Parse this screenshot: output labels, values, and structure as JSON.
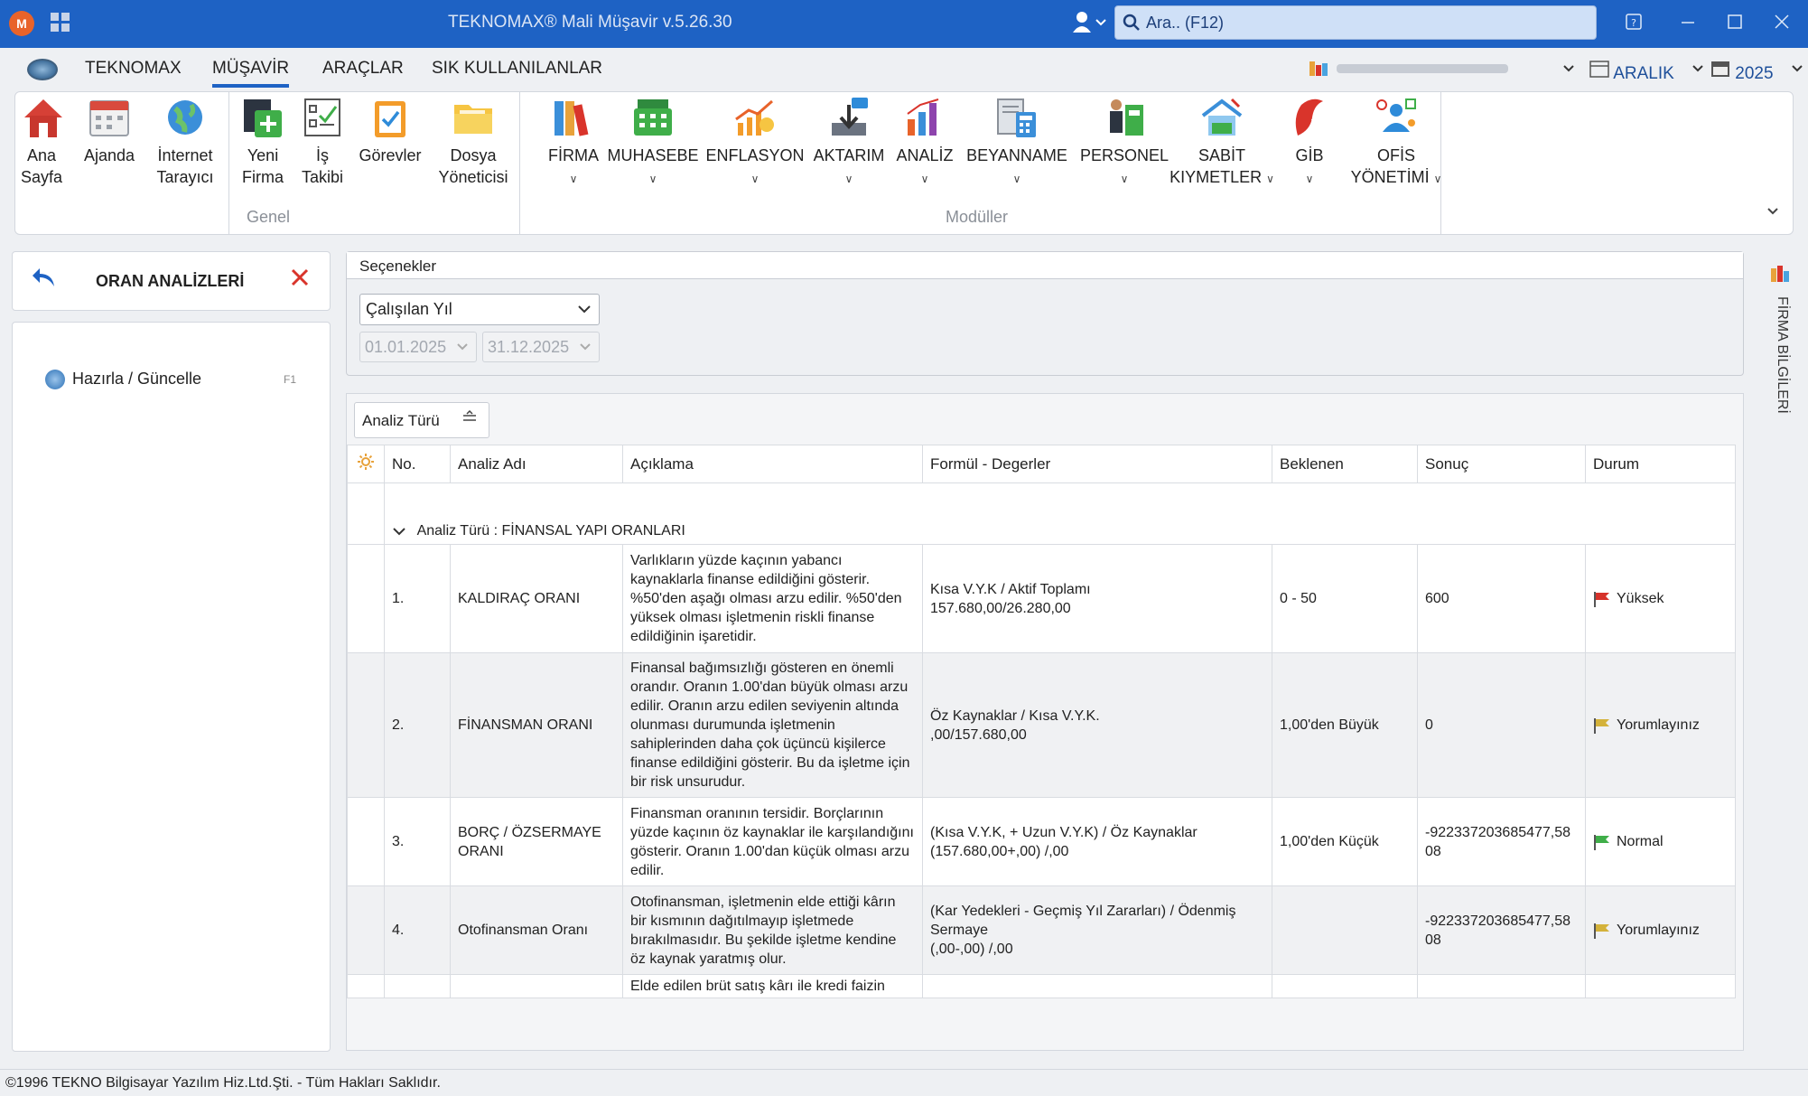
{
  "window": {
    "title": "TEKNOMAX® Mali Müşavir v.5.26.30",
    "app_icon": "M",
    "search_placeholder": "Ara.. (F12)"
  },
  "menu": {
    "items": [
      "TEKNOMAX",
      "MÜŞAVİR",
      "ARAÇLAR",
      "SIK KULLANILANLAR"
    ],
    "active": "MÜŞAVİR",
    "month": "ARALIK",
    "year": "2025"
  },
  "ribbon": {
    "general": {
      "label": "Genel",
      "buttons": [
        {
          "l1": "Ana",
          "l2": "Sayfa",
          "icon": "home-icon"
        },
        {
          "l1": "Ajanda",
          "l2": "",
          "icon": "calendar-icon"
        },
        {
          "l1": "İnternet",
          "l2": "Tarayıcı",
          "icon": "globe-icon"
        },
        {
          "l1": "Yeni",
          "l2": "Firma",
          "icon": "new-company-icon"
        },
        {
          "l1": "İş",
          "l2": "Takibi",
          "icon": "task-list-icon"
        },
        {
          "l1": "Görevler",
          "l2": "",
          "icon": "clipboard-icon"
        },
        {
          "l1": "Dosya",
          "l2": "Yöneticisi",
          "icon": "folder-icon"
        }
      ]
    },
    "modules": {
      "label": "Modüller",
      "buttons": [
        {
          "l1": "FİRMA",
          "l2": "",
          "icon": "binders-icon"
        },
        {
          "l1": "MUHASEBE",
          "l2": "",
          "icon": "cash-register-icon"
        },
        {
          "l1": "ENFLASYON",
          "l2": "",
          "icon": "inflation-chart-icon"
        },
        {
          "l1": "AKTARIM",
          "l2": "",
          "icon": "transfer-icon"
        },
        {
          "l1": "ANALİZ",
          "l2": "",
          "icon": "bar-chart-icon"
        },
        {
          "l1": "BEYANNAME",
          "l2": "",
          "icon": "declaration-icon"
        },
        {
          "l1": "PERSONEL",
          "l2": "",
          "icon": "personnel-icon"
        },
        {
          "l1": "SABİT",
          "l2": "KIYMETLER",
          "icon": "fixed-assets-icon"
        },
        {
          "l1": "GİB",
          "l2": "",
          "icon": "gib-icon"
        },
        {
          "l1": "OFİS",
          "l2": "YÖNETİMİ",
          "icon": "office-management-icon"
        }
      ]
    }
  },
  "left_panel": {
    "title": "ORAN ANALİZLERİ",
    "action_label": "Hazırla / Güncelle",
    "action_key": "F1"
  },
  "options": {
    "header": "Seçenekler",
    "period_select": "Çalışılan Yıl",
    "date_from": "01.01.2025",
    "date_to": "31.12.2025"
  },
  "grid": {
    "group_by_label": "Analiz Türü",
    "columns": [
      "No.",
      "Analiz Adı",
      "Açıklama",
      "Formül - Degerler",
      "Beklenen",
      "Sonuç",
      "Durum"
    ],
    "group_row": "Analiz Türü : FİNANSAL YAPI ORANLARI",
    "rows": [
      {
        "no": "1.",
        "name": "KALDIRAÇ ORANI",
        "desc": "Varlıkların yüzde kaçının yabancı kaynaklarla finanse edildiğini gösterir. %50'den aşağı olması arzu edilir. %50'den yüksek olması işletmenin riskli finanse edildiğinin işaretidir.",
        "formula": "Kısa V.Y.K / Aktif Toplamı\n157.680,00/26.280,00",
        "expected": "0 - 50",
        "result": "600",
        "status": "Yüksek",
        "flag_color": "#d6322a"
      },
      {
        "no": "2.",
        "name": "FİNANSMAN ORANI",
        "desc": "Finansal bağımsızlığı gösteren en önemli orandır. Oranın 1.00'dan büyük olması arzu edilir. Oranın arzu edilen seviyenin altında olunması durumunda işletmenin sahiplerinden daha çok üçüncü kişilerce finanse edildiğini gösterir. Bu da işletme için bir risk unsurudur.",
        "formula": "Öz Kaynaklar / Kısa V.Y.K.\n,00/157.680,00",
        "expected": "1,00'den Büyük",
        "result": "0",
        "status": "Yorumlayınız",
        "flag_color": "#d4b23a"
      },
      {
        "no": "3.",
        "name": "BORÇ / ÖZSERMAYE ORANI",
        "desc": "Finansman oranının tersidir. Borçlarının yüzde kaçının öz kaynaklar ile karşılandığını gösterir. Oranın 1.00'dan küçük olması arzu edilir.",
        "formula": "(Kısa V.Y.K, + Uzun V.Y.K) / Öz Kaynaklar\n(157.680,00+,00) /,00",
        "expected": "1,00'den Küçük",
        "result": "-922337203685477,5808",
        "status": "Normal",
        "flag_color": "#3fae49"
      },
      {
        "no": "4.",
        "name": "Otofinansman Oranı",
        "desc": "Otofinansman, işletmenin elde ettiği kârın bir kısmının dağıtılmayıp işletmede bırakılmasıdır. Bu şekilde işletme kendine öz kaynak yaratmış olur.",
        "formula": "(Kar Yedekleri - Geçmiş Yıl Zararları) / Ödenmiş Sermaye\n(,00-,00) /,00",
        "expected": "",
        "result": "-922337203685477,5808",
        "status": "Yorumlayınız",
        "flag_color": "#d4b23a"
      },
      {
        "no": "",
        "name": "",
        "desc": "Elde edilen brüt satış kârı ile kredi faizin",
        "formula": "",
        "expected": "",
        "result": "",
        "status": "",
        "flag_color": ""
      }
    ]
  },
  "side_tab": "FİRMA BİLGİLERİ",
  "status_bar": "©1996 TEKNO Bilgisayar Yazılım Hiz.Ltd.Şti. - Tüm Hakları Saklıdır."
}
